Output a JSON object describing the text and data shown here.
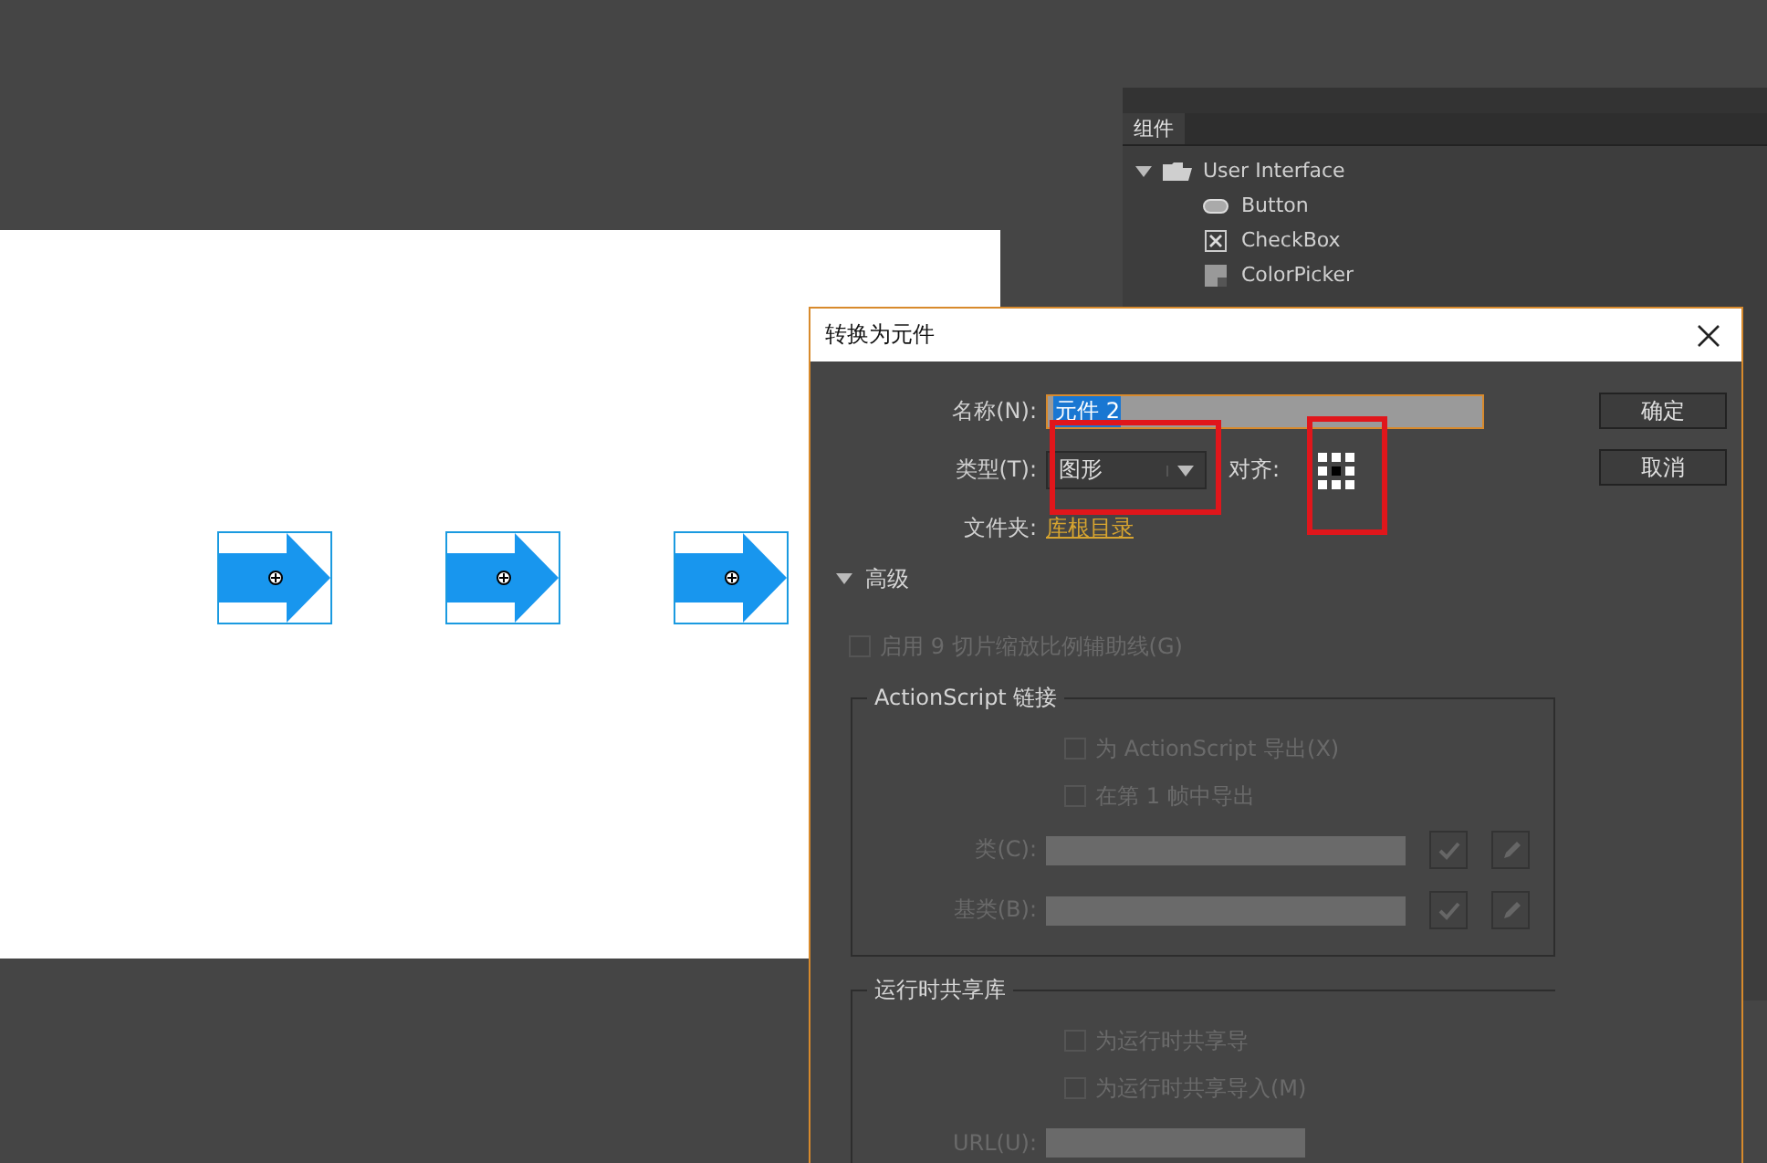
{
  "stage": {
    "symbols": [
      {
        "kind": "arrow"
      },
      {
        "kind": "arrow"
      },
      {
        "kind": "arrow"
      }
    ]
  },
  "components_panel": {
    "tab": "组件",
    "tree": [
      {
        "label": "User Interface",
        "kind": "folder",
        "expanded": true,
        "children": [
          {
            "label": "Button",
            "kind": "button"
          },
          {
            "label": "CheckBox",
            "kind": "checkbox"
          },
          {
            "label": "ColorPicker",
            "kind": "colorpicker"
          }
        ]
      }
    ]
  },
  "dialog": {
    "title": "转换为元件",
    "name_label": "名称(N):",
    "name_value": "元件 2",
    "type_label": "类型(T):",
    "type_value": "图形",
    "type_highlighted": true,
    "align_highlighted": true,
    "align_label": "对齐:",
    "align_points": [
      {
        "selected": false
      },
      {
        "selected": false
      },
      {
        "selected": false
      },
      {
        "selected": false
      },
      {
        "selected": true
      },
      {
        "selected": false
      },
      {
        "selected": false
      },
      {
        "selected": false
      },
      {
        "selected": false
      }
    ],
    "folder_label": "文件夹:",
    "folder_value": "库根目录",
    "buttons": [
      "确定",
      "取消"
    ],
    "advanced": {
      "label": "高级",
      "expanded": true
    },
    "nine_slice": {
      "label": "启用 9 切片缩放比例辅助线(G)",
      "checked": false,
      "disabled": true
    },
    "linkage": {
      "title": "ActionScript 链接",
      "options": [
        {
          "label": "为 ActionScript 导出(X)",
          "checked": false,
          "disabled": true
        },
        {
          "label": "在第 1 帧中导出",
          "checked": false,
          "disabled": true
        }
      ],
      "fields": [
        {
          "label": "类(C):",
          "disabled": true,
          "buttons": true
        },
        {
          "label": "基类(B):",
          "disabled": true,
          "buttons": true
        }
      ]
    },
    "shared_library": {
      "title": "运行时共享库",
      "options": [
        {
          "label": "为运行时共享导",
          "checked": false,
          "disabled": true
        },
        {
          "label": "为运行时共享导入(M)",
          "checked": false,
          "disabled": true
        }
      ],
      "fields": [
        {
          "label": "URL(U):",
          "disabled": true,
          "buttons": false
        }
      ]
    }
  }
}
